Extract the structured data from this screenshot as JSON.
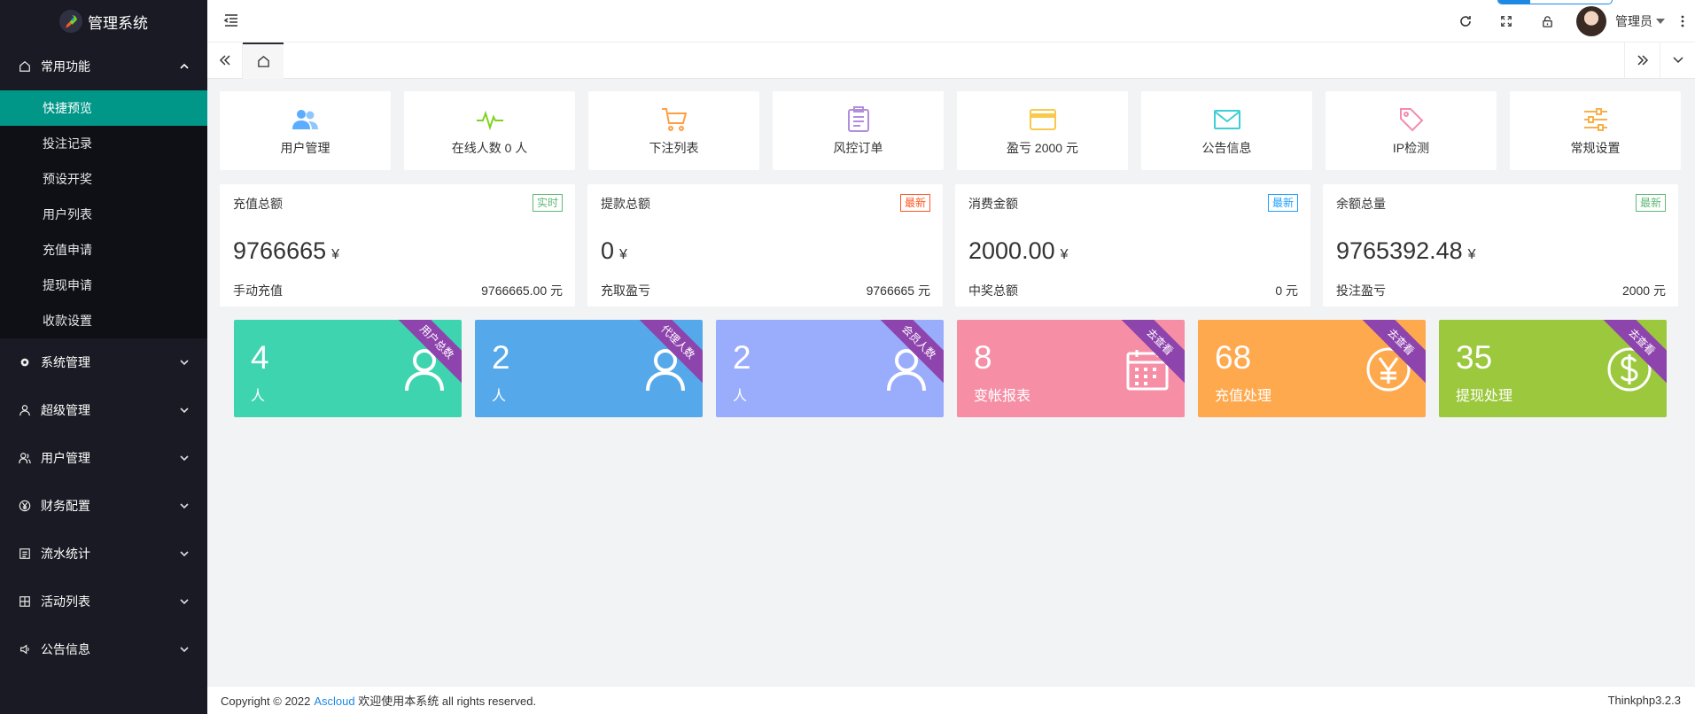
{
  "app": {
    "title": "管理系统"
  },
  "sidebar": {
    "groups": [
      {
        "label": "常用功能",
        "icon": "home-icon",
        "expanded": true,
        "items": [
          "快捷预览",
          "投注记录",
          "预设开奖",
          "用户列表",
          "充值申请",
          "提现申请",
          "收款设置"
        ]
      },
      {
        "label": "系统管理",
        "icon": "gear-icon"
      },
      {
        "label": "超级管理",
        "icon": "user-icon"
      },
      {
        "label": "用户管理",
        "icon": "users-icon"
      },
      {
        "label": "财务配置",
        "icon": "yen-icon"
      },
      {
        "label": "流水统计",
        "icon": "list-icon"
      },
      {
        "label": "活动列表",
        "icon": "grid-icon"
      },
      {
        "label": "公告信息",
        "icon": "speaker-icon"
      }
    ]
  },
  "header": {
    "user_name": "管理员"
  },
  "shortcuts": [
    {
      "label": "用户管理",
      "icon": "users-icon",
      "color": "#5cadff"
    },
    {
      "label": "在线人数 0 人",
      "icon": "pulse-icon",
      "color": "#7ed321"
    },
    {
      "label": "下注列表",
      "icon": "cart-icon",
      "color": "#ff9f43"
    },
    {
      "label": "风控订单",
      "icon": "clipboard-icon",
      "color": "#b18ddc"
    },
    {
      "label": "盈亏 2000 元",
      "icon": "card-icon",
      "color": "#f8c94b"
    },
    {
      "label": "公告信息",
      "icon": "mail-icon",
      "color": "#3ecfd4"
    },
    {
      "label": "IP检测",
      "icon": "tag-icon",
      "color": "#f58ab0"
    },
    {
      "label": "常规设置",
      "icon": "sliders-icon",
      "color": "#f7b14a"
    }
  ],
  "stats": [
    {
      "title": "充值总额",
      "badge": "实时",
      "badge_color": "#5fb878",
      "value": "9766665",
      "unit": "¥",
      "foot_label": "手动充值",
      "foot_value": "9766665.00 元"
    },
    {
      "title": "提款总额",
      "badge": "最新",
      "badge_color": "#ff5722",
      "value": "0",
      "unit": "¥",
      "foot_label": "充取盈亏",
      "foot_value": "9766665 元"
    },
    {
      "title": "消费金额",
      "badge": "最新",
      "badge_color": "#1e9fff",
      "value": "2000.00",
      "unit": "¥",
      "foot_label": "中奖总额",
      "foot_value": "0 元"
    },
    {
      "title": "余额总量",
      "badge": "最新",
      "badge_color": "#5fb878",
      "value": "9765392.48",
      "unit": "¥",
      "foot_label": "投注盈亏",
      "foot_value": "2000 元"
    }
  ],
  "cards": [
    {
      "num": "4",
      "label": "人",
      "ribbon": "用户总数",
      "color": "#3fd4b0",
      "icon": "user-icon"
    },
    {
      "num": "2",
      "label": "人",
      "ribbon": "代理人数",
      "color": "#55a8ea",
      "icon": "user-icon"
    },
    {
      "num": "2",
      "label": "人",
      "ribbon": "会员人数",
      "color": "#9aacfc",
      "icon": "user-icon"
    },
    {
      "num": "8",
      "label": "变帐报表",
      "ribbon": "去查看",
      "color": "#f68fa6",
      "icon": "calendar-icon"
    },
    {
      "num": "68",
      "label": "充值处理",
      "ribbon": "去查看",
      "color": "#ffa94f",
      "icon": "yen-icon"
    },
    {
      "num": "35",
      "label": "提现处理",
      "ribbon": "去查看",
      "color": "#9bc83c",
      "icon": "dollar-icon"
    }
  ],
  "footer": {
    "copyright": "Copyright © 2022",
    "link": "Ascloud",
    "text": "欢迎使用本系统 all rights reserved.",
    "version": "Thinkphp3.2.3"
  }
}
